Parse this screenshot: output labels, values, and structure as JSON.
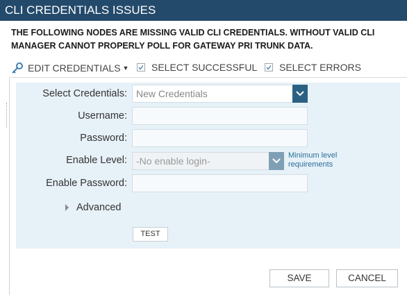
{
  "dialog": {
    "title": "CLI CREDENTIALS ISSUES"
  },
  "warning": {
    "line1": "THE FOLLOWING NODES ARE MISSING VALID CLI CREDENTIALS. WITHOUT VALID CLI",
    "line2": "MANAGER CANNOT PROPERLY POLL FOR GATEWAY PRI TRUNK DATA."
  },
  "toolbar": {
    "edit_credentials": "EDIT CREDENTIALS",
    "select_successful": "SELECT SUCCESSFUL",
    "select_errors": "SELECT ERRORS"
  },
  "form": {
    "select_credentials": {
      "label": "Select Credentials:",
      "value": "New Credentials"
    },
    "username": {
      "label": "Username:",
      "value": ""
    },
    "password": {
      "label": "Password:",
      "value": ""
    },
    "enable_level": {
      "label": "Enable Level:",
      "value": "-No enable login-"
    },
    "enable_password": {
      "label": "Enable Password:",
      "value": ""
    },
    "min_level_link": {
      "line1": "Minimum level",
      "line2": "requirements"
    },
    "advanced": "Advanced",
    "test": "TEST"
  },
  "footer": {
    "save": "SAVE",
    "cancel": "CANCEL"
  },
  "colors": {
    "titlebar": "#244a6b",
    "panel": "#e7f1f8",
    "accent": "#2a6182",
    "link": "#2b6f9a"
  },
  "icons": {
    "edit": "key-icon",
    "checkbox": "checkbox-checked-icon",
    "dropdown": "chevron-down-icon",
    "advanced": "triangle-right-icon"
  }
}
